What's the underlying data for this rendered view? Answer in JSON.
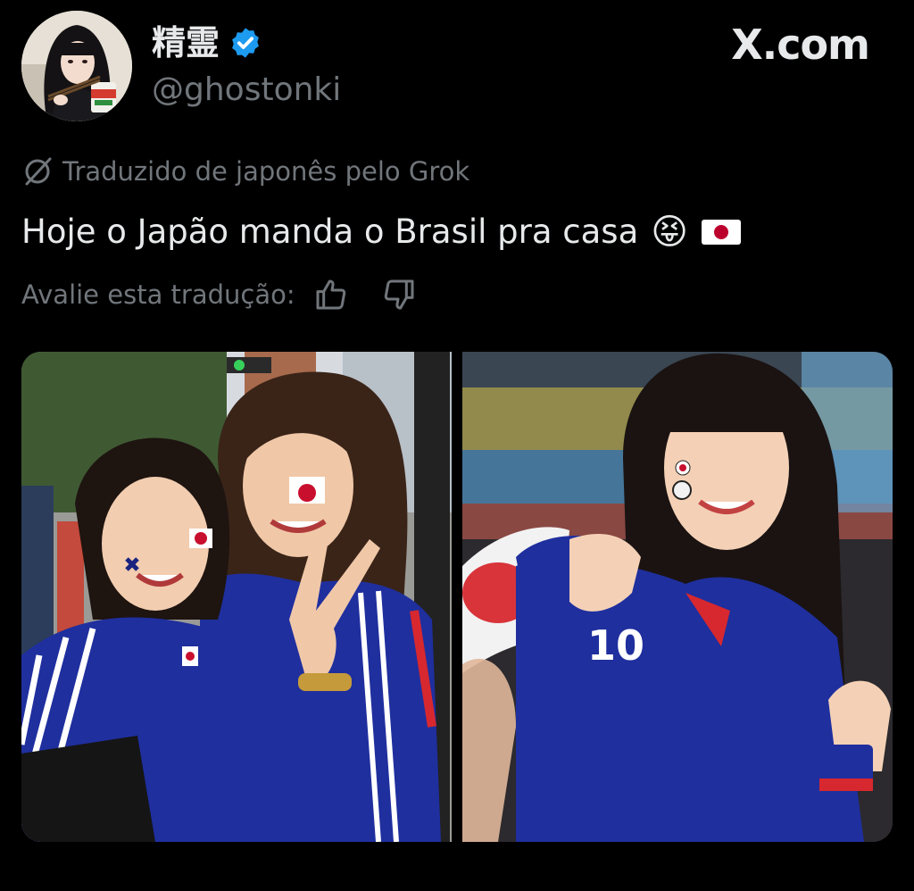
{
  "author": {
    "display_name": "精霊",
    "handle": "@ghostonki",
    "verified": true,
    "avatar_icon": "profile-photo"
  },
  "brand": {
    "label": "X.com"
  },
  "translation": {
    "label": "Traduzido de japonês pelo Grok",
    "icon": "grok-icon"
  },
  "tweet": {
    "text": "Hoje o Japão manda o Brasil pra casa",
    "emoji": "😝",
    "flag_label": "Japan flag"
  },
  "rating": {
    "label": "Avalie esta tradução:",
    "thumbs_up_icon": "thumbs-up-icon",
    "thumbs_down_icon": "thumbs-down-icon"
  },
  "media": [
    {
      "description_icon": "photo-two-fans-street"
    },
    {
      "description_icon": "photo-fan-stadium"
    }
  ],
  "colors": {
    "background": "#000000",
    "text_primary": "#e7e9ea",
    "text_secondary": "#71767b",
    "verified_blue": "#1d9bf0",
    "jersey_blue": "#1f2f9e"
  }
}
